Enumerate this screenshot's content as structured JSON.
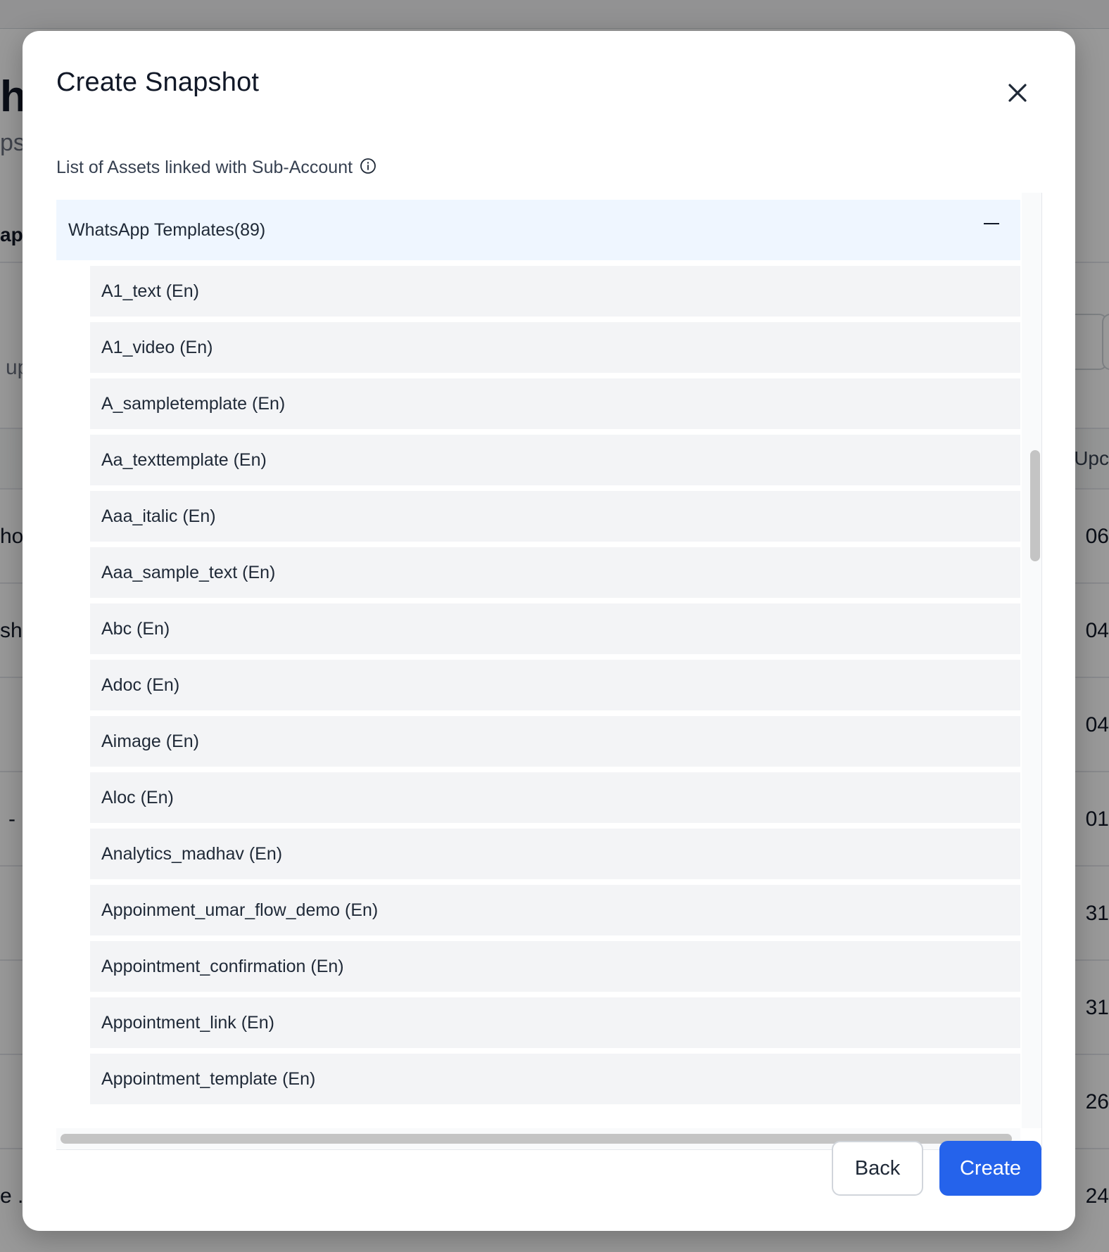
{
  "background": {
    "heading_fragment": "h",
    "sub_fragment": "ps",
    "section_fragment": "aps",
    "up_fragment": "up",
    "column_header_fragment": ": Upc",
    "left_cells": [
      "hot",
      "sho",
      "-",
      "e ."
    ],
    "right_cells": [
      "06",
      "04",
      "04",
      "01",
      "31",
      "31",
      "26",
      "24"
    ]
  },
  "modal": {
    "title": "Create Snapshot",
    "assets_label": "List of Assets linked with Sub-Account",
    "group": {
      "title": "WhatsApp Templates(89)",
      "items": [
        "A1_text (En)",
        "A1_video (En)",
        "A_sampletemplate (En)",
        "Aa_texttemplate (En)",
        "Aaa_italic (En)",
        "Aaa_sample_text (En)",
        "Abc (En)",
        "Adoc (En)",
        "Aimage (En)",
        "Aloc (En)",
        "Analytics_madhav (En)",
        "Appoinment_umar_flow_demo (En)",
        "Appointment_confirmation (En)",
        "Appointment_link (En)",
        "Appointment_template (En)"
      ]
    },
    "buttons": {
      "back": "Back",
      "create": "Create"
    }
  },
  "icons": {
    "close": "close-icon",
    "info": "info-icon",
    "collapse": "minus-icon"
  },
  "colors": {
    "primary": "#2563eb",
    "group_header_bg": "#eff6ff",
    "item_bg": "#f3f4f6",
    "overlay": "rgba(0,0,0,0.40)"
  }
}
